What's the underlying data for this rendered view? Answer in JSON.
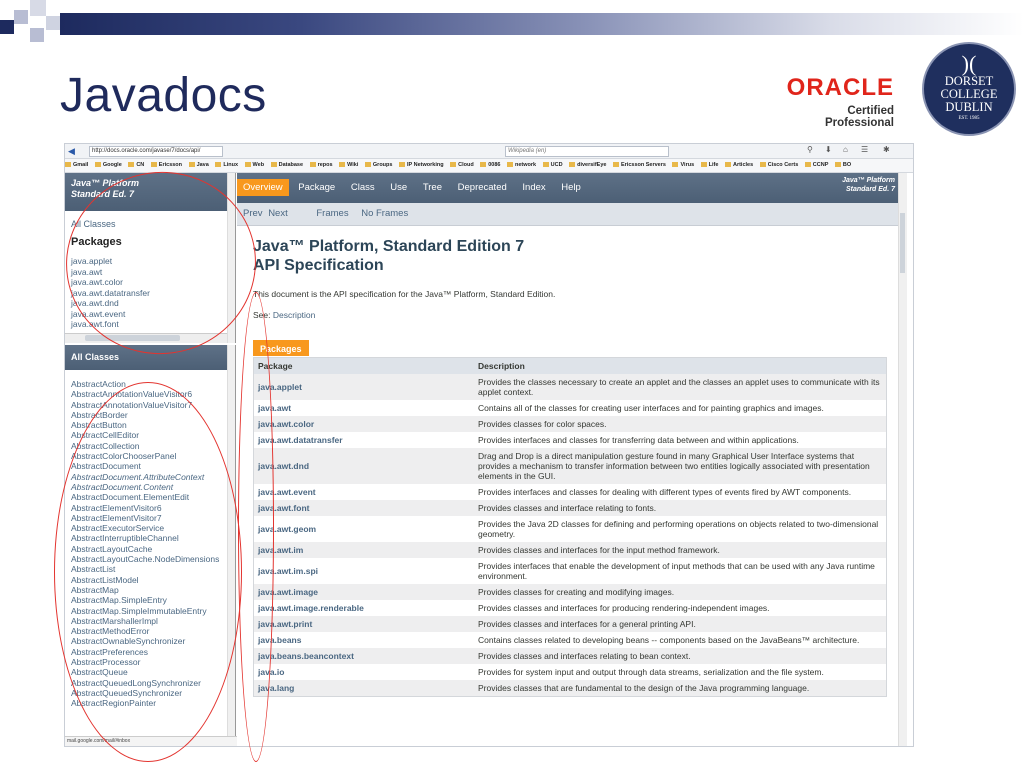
{
  "slide": {
    "title": "Javadocs",
    "oracle_word": "ORACLE",
    "oracle_sub": "Certified Professional",
    "seal_lines": [
      "DORSET",
      "COLLEGE",
      "DUBLIN"
    ],
    "seal_est": "EST. 1985"
  },
  "browser": {
    "url": "http://docs.oracle.com/javase/7/docs/api/",
    "search_placeholder": "Wikipedia (en)",
    "bookmarks": [
      "Gmail",
      "Google",
      "CN",
      "Ericsson",
      "Java",
      "Linux",
      "Web",
      "Database",
      "repos",
      "Wiki",
      "Groups",
      "IP Networking",
      "Cloud",
      "0086",
      "network",
      "UCD",
      "diversifEye",
      "Ericsson Servers",
      "Virus",
      "Life",
      "Articles",
      "Cisco Certs",
      "CCNP",
      "BO"
    ],
    "status_url": "mail.google.com/mail/#inbox"
  },
  "left_top": {
    "platform_l1": "Java™ Platform",
    "platform_l2": "Standard Ed. 7",
    "all_classes": "All Classes",
    "packages_heading": "Packages",
    "packages": [
      "java.applet",
      "java.awt",
      "java.awt.color",
      "java.awt.datatransfer",
      "java.awt.dnd",
      "java.awt.event",
      "java.awt.font"
    ]
  },
  "left_bottom": {
    "heading": "All Classes",
    "classes": [
      {
        "name": "AbstractAction",
        "italic": false
      },
      {
        "name": "AbstractAnnotationValueVisitor6",
        "italic": false
      },
      {
        "name": "AbstractAnnotationValueVisitor7",
        "italic": false
      },
      {
        "name": "AbstractBorder",
        "italic": false
      },
      {
        "name": "AbstractButton",
        "italic": false
      },
      {
        "name": "AbstractCellEditor",
        "italic": false
      },
      {
        "name": "AbstractCollection",
        "italic": false
      },
      {
        "name": "AbstractColorChooserPanel",
        "italic": false
      },
      {
        "name": "AbstractDocument",
        "italic": false
      },
      {
        "name": "AbstractDocument.AttributeContext",
        "italic": true
      },
      {
        "name": "AbstractDocument.Content",
        "italic": true
      },
      {
        "name": "AbstractDocument.ElementEdit",
        "italic": false
      },
      {
        "name": "AbstractElementVisitor6",
        "italic": false
      },
      {
        "name": "AbstractElementVisitor7",
        "italic": false
      },
      {
        "name": "AbstractExecutorService",
        "italic": false
      },
      {
        "name": "AbstractInterruptibleChannel",
        "italic": false
      },
      {
        "name": "AbstractLayoutCache",
        "italic": false
      },
      {
        "name": "AbstractLayoutCache.NodeDimensions",
        "italic": false
      },
      {
        "name": "AbstractList",
        "italic": false
      },
      {
        "name": "AbstractListModel",
        "italic": false
      },
      {
        "name": "AbstractMap",
        "italic": false
      },
      {
        "name": "AbstractMap.SimpleEntry",
        "italic": false
      },
      {
        "name": "AbstractMap.SimpleImmutableEntry",
        "italic": false
      },
      {
        "name": "AbstractMarshallerImpl",
        "italic": false
      },
      {
        "name": "AbstractMethodError",
        "italic": false
      },
      {
        "name": "AbstractOwnableSynchronizer",
        "italic": false
      },
      {
        "name": "AbstractPreferences",
        "italic": false
      },
      {
        "name": "AbstractProcessor",
        "italic": false
      },
      {
        "name": "AbstractQueue",
        "italic": false
      },
      {
        "name": "AbstractQueuedLongSynchronizer",
        "italic": false
      },
      {
        "name": "AbstractQueuedSynchronizer",
        "italic": false
      },
      {
        "name": "AbstractRegionPainter",
        "italic": false
      }
    ]
  },
  "right": {
    "tabs": [
      "Overview",
      "Package",
      "Class",
      "Use",
      "Tree",
      "Deprecated",
      "Index",
      "Help"
    ],
    "platform_l1": "Java™ Platform",
    "platform_l2": "Standard Ed. 7",
    "subnav": [
      "Prev",
      "Next",
      "Frames",
      "No Frames"
    ],
    "title_l1": "Java™ Platform, Standard Edition 7",
    "title_l2": "API Specification",
    "description": "This document is the API specification for the Java™ Platform, Standard Edition.",
    "see_prefix": "See: ",
    "see_link": "Description",
    "table_caption": "Packages",
    "col_package": "Package",
    "col_description": "Description",
    "rows": [
      {
        "pkg": "java.applet",
        "desc": "Provides the classes necessary to create an applet and the classes an applet uses to communicate with its applet context."
      },
      {
        "pkg": "java.awt",
        "desc": "Contains all of the classes for creating user interfaces and for painting graphics and images."
      },
      {
        "pkg": "java.awt.color",
        "desc": "Provides classes for color spaces."
      },
      {
        "pkg": "java.awt.datatransfer",
        "desc": "Provides interfaces and classes for transferring data between and within applications."
      },
      {
        "pkg": "java.awt.dnd",
        "desc": "Drag and Drop is a direct manipulation gesture found in many Graphical User Interface systems that provides a mechanism to transfer information between two entities logically associated with presentation elements in the GUI."
      },
      {
        "pkg": "java.awt.event",
        "desc": "Provides interfaces and classes for dealing with different types of events fired by AWT components."
      },
      {
        "pkg": "java.awt.font",
        "desc": "Provides classes and interface relating to fonts."
      },
      {
        "pkg": "java.awt.geom",
        "desc": "Provides the Java 2D classes for defining and performing operations on objects related to two-dimensional geometry."
      },
      {
        "pkg": "java.awt.im",
        "desc": "Provides classes and interfaces for the input method framework."
      },
      {
        "pkg": "java.awt.im.spi",
        "desc": "Provides interfaces that enable the development of input methods that can be used with any Java runtime environment."
      },
      {
        "pkg": "java.awt.image",
        "desc": "Provides classes for creating and modifying images."
      },
      {
        "pkg": "java.awt.image.renderable",
        "desc": "Provides classes and interfaces for producing rendering-independent images."
      },
      {
        "pkg": "java.awt.print",
        "desc": "Provides classes and interfaces for a general printing API."
      },
      {
        "pkg": "java.beans",
        "desc": "Contains classes related to developing beans -- components based on the JavaBeans™ architecture."
      },
      {
        "pkg": "java.beans.beancontext",
        "desc": "Provides classes and interfaces relating to bean context."
      },
      {
        "pkg": "java.io",
        "desc": "Provides for system input and output through data streams, serialization and the file system."
      },
      {
        "pkg": "java.lang",
        "desc": "Provides classes that are fundamental to the design of the Java programming language."
      }
    ]
  },
  "colors": {
    "accent_orange": "#f8981d",
    "nav_blue": "#4c5f75",
    "link_blue": "#4a6782",
    "annotation_red": "#e3342f"
  }
}
